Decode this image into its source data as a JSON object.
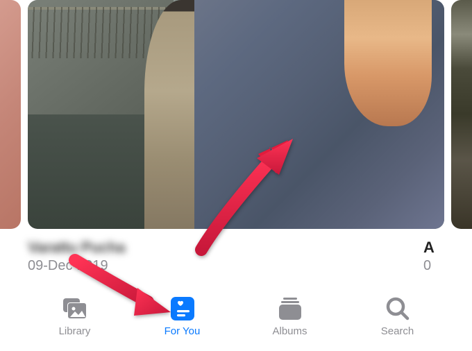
{
  "memory": {
    "title_blurred": "Varattu Pucha",
    "date": "09-Dec-2019",
    "next_title_partial": "A",
    "next_date_partial": "0"
  },
  "tabbar": {
    "library": "Library",
    "for_you": "For You",
    "albums": "Albums",
    "search": "Search",
    "active_tab": "for_you"
  },
  "colors": {
    "active": "#0a7aff",
    "inactive": "#8e8e93",
    "arrow": "#e21b3c"
  }
}
